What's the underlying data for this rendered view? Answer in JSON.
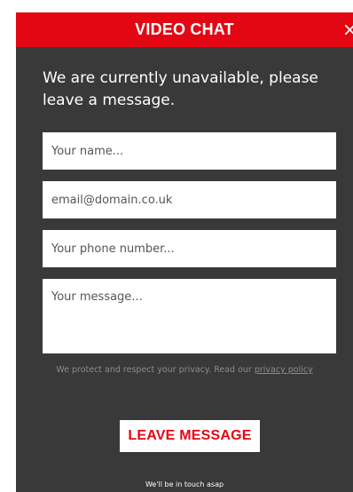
{
  "header": {
    "title": "VIDEO CHAT",
    "close_glyph": "×",
    "close_icon": "close-icon",
    "background_color": "#e30613"
  },
  "intro_text": "We are currently unavailable, please leave a message.",
  "form": {
    "name": {
      "value": "",
      "placeholder": "Your name..."
    },
    "email": {
      "value": "",
      "placeholder": "email@domain.co.uk"
    },
    "phone": {
      "value": "",
      "placeholder": "Your phone number..."
    },
    "message": {
      "value": "",
      "placeholder": "Your message..."
    }
  },
  "privacy": {
    "text": "We protect and respect your privacy. Read our ",
    "link_label": "privacy policy"
  },
  "submit_label": "LEAVE MESSAGE",
  "footnote": "We'll be in touch asap",
  "colors": {
    "panel_background": "#393939",
    "accent": "#e30613"
  }
}
